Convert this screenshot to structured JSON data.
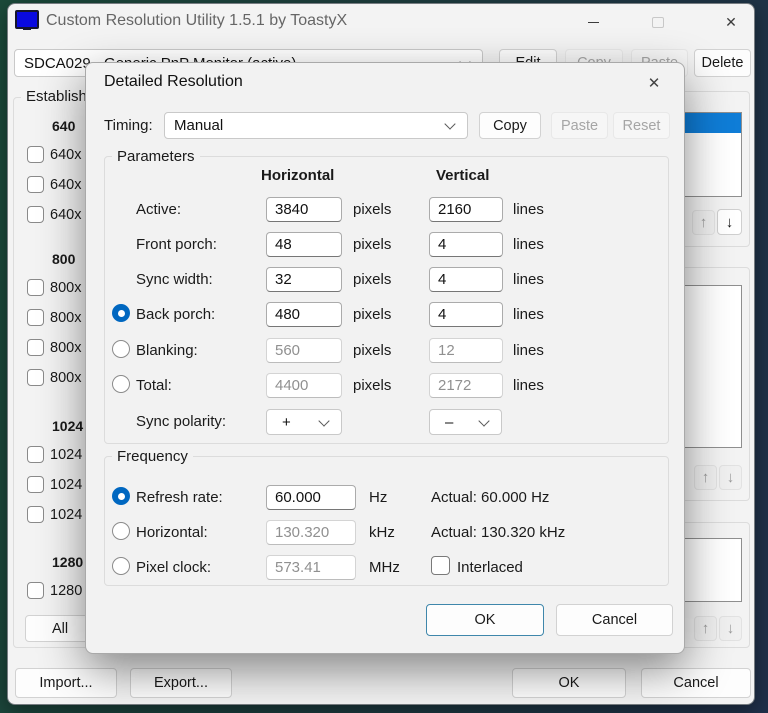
{
  "colors": {
    "accent_blue": "#0f7dd7",
    "radio_blue": "#0067c0"
  },
  "icons": {
    "up_arrow": "↑",
    "down_arrow": "↓",
    "close": "✕"
  },
  "main_window": {
    "title": "Custom Resolution Utility 1.5.1 by ToastyX",
    "monitor_select": {
      "value": "SDCA029 - Generic PnP Monitor (active)"
    },
    "toolbar": {
      "edit": "Edit",
      "copy": "Copy",
      "paste": "Paste",
      "delete": "Delete"
    },
    "established": {
      "label": "Establish",
      "groups": [
        {
          "header": "640",
          "items": [
            "640x",
            "640x",
            "640x"
          ]
        },
        {
          "header": "800",
          "items": [
            "800x",
            "800x",
            "800x",
            "800x"
          ]
        },
        {
          "header": "1024",
          "items": [
            "1024",
            "1024",
            "1024"
          ]
        },
        {
          "header": "1280",
          "items": [
            "1280"
          ]
        }
      ],
      "all_button": "All"
    },
    "footer": {
      "import": "Import...",
      "export": "Export...",
      "ok": "OK",
      "cancel": "Cancel"
    }
  },
  "dialog": {
    "title": "Detailed Resolution",
    "timing": {
      "label": "Timing:",
      "value": "Manual",
      "copy": "Copy",
      "paste": "Paste",
      "reset": "Reset"
    },
    "parameters": {
      "label": "Parameters",
      "columns": {
        "horizontal": "Horizontal",
        "vertical": "Vertical"
      },
      "rows": [
        {
          "label": "Active:",
          "h": "3840",
          "h_unit": "pixels",
          "v": "2160",
          "v_unit": "lines",
          "editable": true
        },
        {
          "label": "Front porch:",
          "h": "48",
          "h_unit": "pixels",
          "v": "4",
          "v_unit": "lines",
          "editable": true
        },
        {
          "label": "Sync width:",
          "h": "32",
          "h_unit": "pixels",
          "v": "4",
          "v_unit": "lines",
          "editable": true
        },
        {
          "label": "Back porch:",
          "h": "480",
          "h_unit": "pixels",
          "v": "4",
          "v_unit": "lines",
          "editable": true,
          "radio": "selected"
        },
        {
          "label": "Blanking:",
          "h": "560",
          "h_unit": "pixels",
          "v": "12",
          "v_unit": "lines",
          "editable": false,
          "radio": "unselected"
        },
        {
          "label": "Total:",
          "h": "4400",
          "h_unit": "pixels",
          "v": "2172",
          "v_unit": "lines",
          "editable": false,
          "radio": "unselected"
        }
      ],
      "sync_polarity": {
        "label": "Sync polarity:",
        "h_value": "+",
        "v_value": "–"
      }
    },
    "frequency": {
      "label": "Frequency",
      "rows": [
        {
          "label": "Refresh rate:",
          "value": "60.000",
          "unit": "Hz",
          "actual": "Actual: 60.000 Hz",
          "radio": "selected",
          "editable": true
        },
        {
          "label": "Horizontal:",
          "value": "130.320",
          "unit": "kHz",
          "actual": "Actual: 130.320 kHz",
          "radio": "unselected",
          "editable": false
        },
        {
          "label": "Pixel clock:",
          "value": "573.41",
          "unit": "MHz",
          "radio": "unselected",
          "editable": false
        }
      ],
      "interlaced_label": "Interlaced"
    },
    "buttons": {
      "ok": "OK",
      "cancel": "Cancel"
    }
  }
}
